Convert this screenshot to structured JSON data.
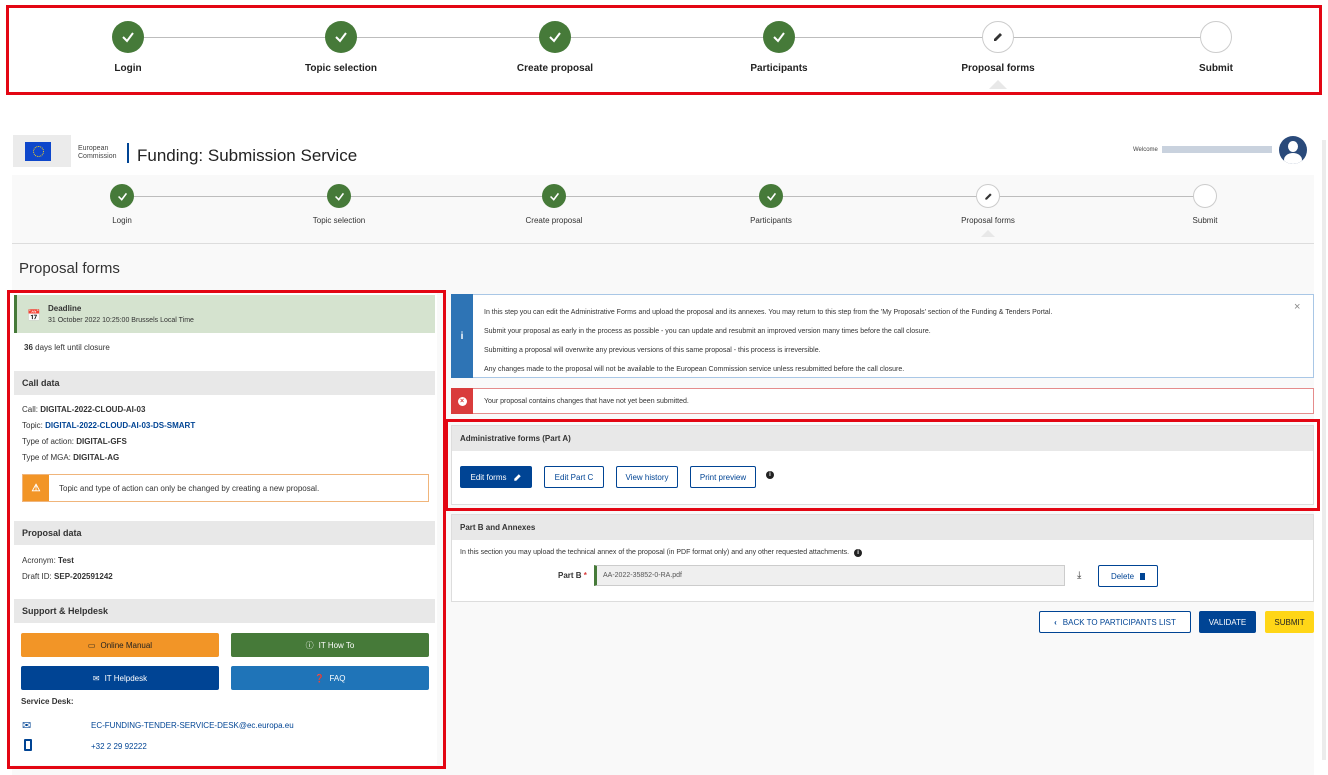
{
  "top_stepper": {
    "steps": [
      {
        "label": "Login",
        "state": "done"
      },
      {
        "label": "Topic selection",
        "state": "done"
      },
      {
        "label": "Create proposal",
        "state": "done"
      },
      {
        "label": "Participants",
        "state": "done"
      },
      {
        "label": "Proposal forms",
        "state": "current"
      },
      {
        "label": "Submit",
        "state": "todo"
      }
    ]
  },
  "header": {
    "logo_line1": "European",
    "logo_line2": "Commission",
    "app_title": "Funding: Submission Service",
    "welcome": "Welcome"
  },
  "page": {
    "title": "Proposal forms"
  },
  "deadline": {
    "title": "Deadline",
    "date": "31 October 2022 10:25:00 Brussels Local Time",
    "days_number": "36",
    "days_text": "days left until closure"
  },
  "call_data": {
    "heading": "Call data",
    "call_label": "Call:",
    "call_value": "DIGITAL-2022-CLOUD-AI-03",
    "topic_label": "Topic:",
    "topic_value": "DIGITAL-2022-CLOUD-AI-03-DS-SMART",
    "action_label": "Type of action:",
    "action_value": "DIGITAL-GFS",
    "mga_label": "Type of MGA:",
    "mga_value": "DIGITAL-AG",
    "warning": "Topic and type of action can only be changed by creating a new proposal."
  },
  "proposal_data": {
    "heading": "Proposal data",
    "acronym_label": "Acronym:",
    "acronym_value": "Test",
    "draft_label": "Draft ID:",
    "draft_value": "SEP-202591242"
  },
  "support": {
    "heading": "Support & Helpdesk",
    "online_manual": "Online Manual",
    "it_how_to": "IT How To",
    "it_helpdesk": "IT Helpdesk",
    "faq": "FAQ",
    "service_desk_label": "Service Desk:",
    "email": "EC-FUNDING-TENDER-SERVICE-DESK@ec.europa.eu",
    "phone": "+32 2 29 92222"
  },
  "info_box": {
    "line1": "In this step you can edit the Administrative Forms and upload the proposal and its annexes. You may return to this step from the 'My Proposals' section of the Funding & Tenders Portal.",
    "line2": "Submit your proposal as early in the process as possible - you can update and resubmit an improved version many times before the call closure.",
    "line3": "Submitting a proposal will overwrite any previous versions of this same proposal - this process is irreversible.",
    "line4": "Any changes made to the proposal will not be available to the European Commission service unless resubmitted before the call closure."
  },
  "error_box": {
    "text": "Your proposal contains changes that have not yet been submitted."
  },
  "admin_forms": {
    "heading": "Administrative forms (Part A)",
    "edit_forms": "Edit forms",
    "edit_part_c": "Edit Part C",
    "view_history": "View history",
    "print_preview": "Print preview"
  },
  "part_b": {
    "heading": "Part B and Annexes",
    "description": "In this section you may upload the technical annex of the proposal (in PDF format only) and any other requested attachments.",
    "label": "Part B",
    "required_mark": "*",
    "file": "AA-2022-35852-0-RA.pdf",
    "delete": "Delete"
  },
  "actions": {
    "back": "BACK TO PARTICIPANTS LIST",
    "validate": "VALIDATE",
    "submit": "SUBMIT"
  },
  "colors": {
    "done": "#467a39",
    "primary": "#004494",
    "orange": "#f29527",
    "green": "#467a39",
    "info_blue": "#2e74b5",
    "error_red": "#d93c3c",
    "submit_yellow": "#ffd617",
    "deadline_green": "#d5e3cf"
  }
}
